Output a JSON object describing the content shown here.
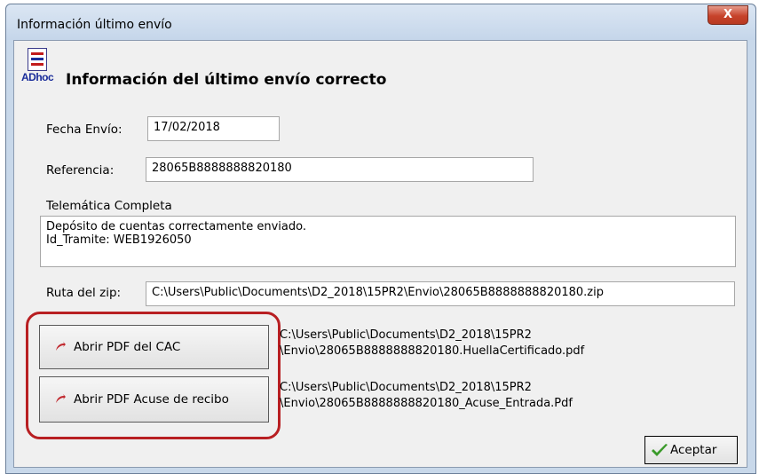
{
  "window": {
    "title": "Información último envío",
    "close_label": "X"
  },
  "app_icon": {
    "label": "ADhoc",
    "icon": "adhoc-document-icon"
  },
  "heading": "Información del último envío correcto",
  "fecha_envio": {
    "label": "Fecha Envío:",
    "value": "17/02/2018"
  },
  "referencia": {
    "label": "Referencia:",
    "value": "28065B8888888820180"
  },
  "telematica": {
    "label": "Telemática Completa",
    "lines": [
      "Depósito de cuentas correctamente enviado.",
      "Id_Tramite: WEB1926050"
    ]
  },
  "ruta_zip": {
    "label": "Ruta del zip:",
    "value": "C:\\Users\\Public\\Documents\\D2_2018\\15PR2\\Envio\\28065B8888888820180.zip"
  },
  "buttons": {
    "cac": {
      "label": "Abrir PDF del CAC",
      "icon": "acrobat-pdf-icon"
    },
    "acuse": {
      "label": "Abrir PDF Acuse de recibo",
      "icon": "acrobat-pdf-icon"
    },
    "aceptar": {
      "label": "Aceptar",
      "icon": "check-icon"
    }
  },
  "paths": {
    "cac": [
      "C:\\Users\\Public\\Documents\\D2_2018\\15PR2",
      "\\Envio\\28065B8888888820180.HuellaCertificado.pdf"
    ],
    "acuse": [
      "C:\\Users\\Public\\Documents\\D2_2018\\15PR2",
      "\\Envio\\28065B8888888820180_Acuse_Entrada.Pdf"
    ]
  },
  "colors": {
    "highlight": "#b81f22",
    "check": "#3a9a2a",
    "pdf_icon": "#c0272d"
  }
}
